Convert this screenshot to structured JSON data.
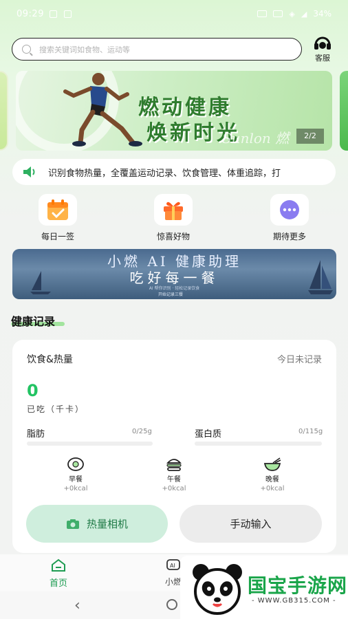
{
  "status_bar": {
    "time": "09:29",
    "battery": "34%"
  },
  "search": {
    "placeholder": "搜索关键词如食物、运动等"
  },
  "service": {
    "label": "客服"
  },
  "banner": {
    "title_line1": "燃动健康",
    "title_line2": "焕新时光",
    "signature": "Sunlon 燃",
    "counter": "2/2"
  },
  "notice": {
    "text": "识别食物热量，全覆盖运动记录、饮食管理、体重追踪，打"
  },
  "quick_actions": [
    {
      "label": "每日一签",
      "icon": "calendar-check-icon"
    },
    {
      "label": "惊喜好物",
      "icon": "gift-icon"
    },
    {
      "label": "期待更多",
      "icon": "more-dots-icon"
    }
  ],
  "ai_banner": {
    "title_line1": "小燃 AI 健康助理",
    "title_line2": "吃好每一餐",
    "subtitle": "AI 帮你识别 · 轻松记录饮食",
    "button": "开始记录三餐"
  },
  "section": {
    "title": "健康记录"
  },
  "diet_card": {
    "title": "饮食&热量",
    "status": "今日未记录",
    "kcal_value": "0",
    "kcal_label": "已吃（千卡）",
    "fat": {
      "label": "脂肪",
      "value": "0/25g"
    },
    "protein": {
      "label": "蛋白质",
      "value": "0/115g"
    },
    "meals": [
      {
        "name": "早餐",
        "kcal": "+0kcal",
        "icon": "breakfast-egg-icon"
      },
      {
        "name": "午餐",
        "kcal": "+0kcal",
        "icon": "lunch-burger-icon"
      },
      {
        "name": "晚餐",
        "kcal": "+0kcal",
        "icon": "dinner-bowl-icon"
      }
    ],
    "camera_button": "热量相机",
    "manual_button": "手动输入"
  },
  "bottom_nav": {
    "home": "首页",
    "ai": "小燃"
  },
  "watermark": {
    "brand": "国宝手游网",
    "url": "- WWW.GB315.COM -"
  },
  "colors": {
    "accent": "#23c363",
    "nav_active": "#1e9c52",
    "banner_text": "#2f7c2e"
  }
}
